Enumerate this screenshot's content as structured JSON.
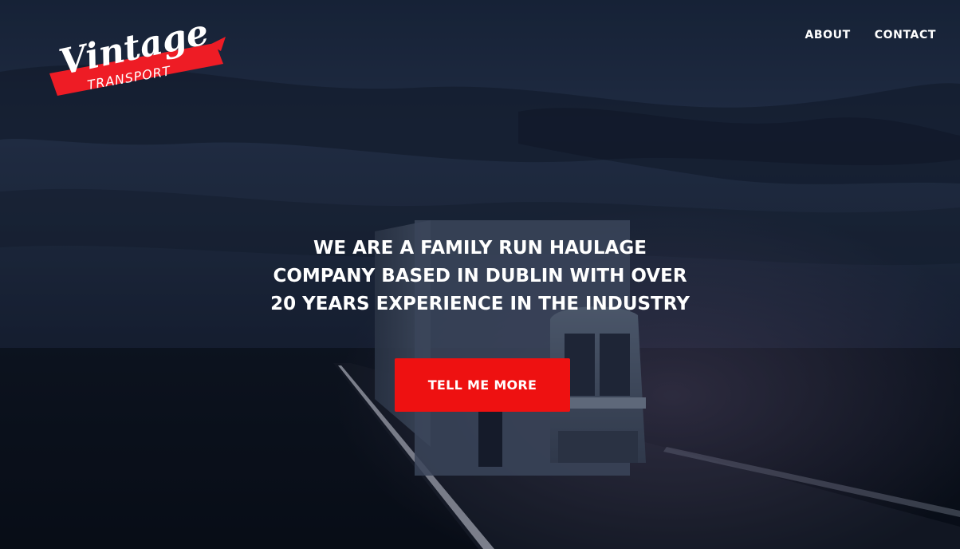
{
  "brand": {
    "script_text": "Vintage",
    "ribbon_text": "TRANSPORT",
    "ribbon_color": "#ee1c25"
  },
  "nav": {
    "items": [
      {
        "label": "ABOUT"
      },
      {
        "label": "CONTACT"
      }
    ]
  },
  "hero": {
    "headline_lines": [
      "WE ARE A FAMILY RUN HAULAGE",
      "COMPANY BASED IN DUBLIN WITH OVER",
      "20 YEARS EXPERIENCE IN THE INDUSTRY"
    ],
    "cta_label": "TELL ME MORE",
    "cta_color": "#ee1111",
    "background_icon": "truck-on-highway-at-dusk"
  }
}
